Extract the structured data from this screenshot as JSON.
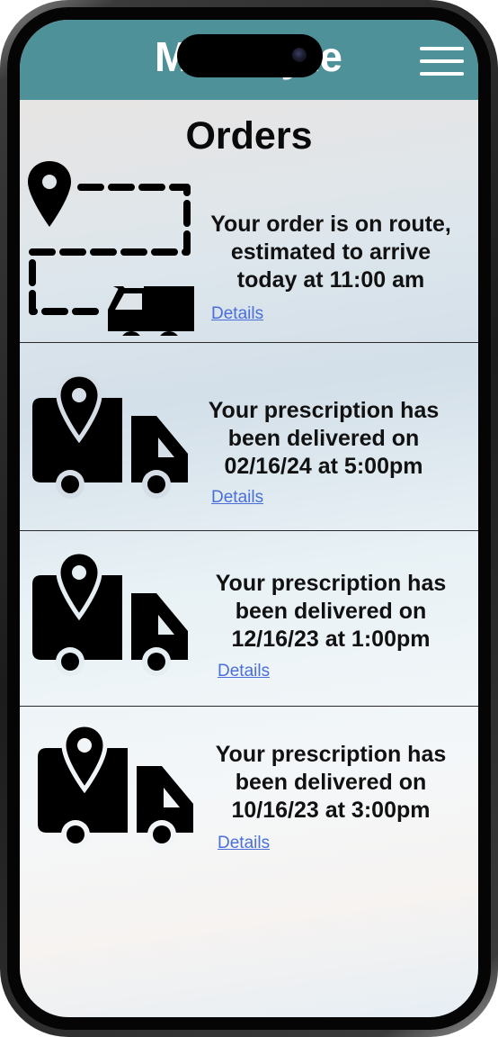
{
  "header": {
    "brand": "MediSyte",
    "menu_icon": "hamburger-menu-icon",
    "background": "#4f9198"
  },
  "page_title": "Orders",
  "orders": [
    {
      "icon": "route-map-truck-icon",
      "status": "Your order is on route, estimated to arrive today at 11:00 am",
      "lines": [
        "Your order is on route,",
        "estimated to arrive",
        "today at 11:00 am"
      ],
      "link": "Details"
    },
    {
      "icon": "delivered-map-truck-icon",
      "status": "Your prescription has been delivered on 02/16/24 at 5:00pm",
      "lines": [
        "Your prescription has",
        "been delivered on",
        "02/16/24 at 5:00pm"
      ],
      "link": "Details"
    },
    {
      "icon": "delivered-map-truck-icon",
      "status": "Your prescription has been delivered on 12/16/23 at 1:00pm",
      "lines": [
        "Your prescription has",
        "been delivered on",
        "12/16/23 at 1:00pm"
      ],
      "link": "Details"
    },
    {
      "icon": "delivered-map-truck-icon",
      "status": "Your prescription has been delivered on 10/16/23 at 3:00pm",
      "lines": [
        "Your prescription has",
        "been delivered on",
        "10/16/23 at 3:00pm"
      ],
      "link": "Details"
    }
  ],
  "colors": {
    "link": "#4a6fd8",
    "text": "#111111"
  }
}
